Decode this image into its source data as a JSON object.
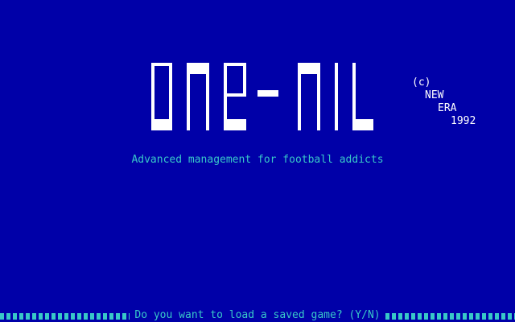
{
  "game": {
    "title": "ONE-NIL",
    "copyright": {
      "symbol": "(c)",
      "company_line1": "NEW",
      "company_line2": "ERA",
      "year": "1992"
    },
    "tagline": "Advanced management for football addicts"
  },
  "prompt": {
    "text": "Do you want to load a saved game? (Y/N)"
  },
  "colors": {
    "background": "#0000a8",
    "logo": "#ffffff",
    "text_cyan": "#38c8c8",
    "text_white": "#ffffff"
  }
}
